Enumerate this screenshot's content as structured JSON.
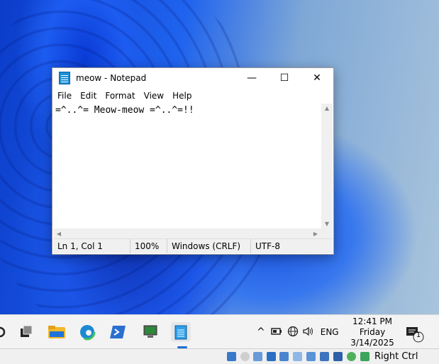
{
  "notepad": {
    "title": "meow - Notepad",
    "window_buttons": {
      "minimize": "—",
      "maximize": "☐",
      "close": "✕"
    },
    "menu": [
      "File",
      "Edit",
      "Format",
      "View",
      "Help"
    ],
    "content": "=^..^= Meow-meow =^..^=!!",
    "status": {
      "position": "Ln 1, Col 1",
      "zoom": "100%",
      "line_ending": "Windows (CRLF)",
      "encoding": "UTF-8"
    }
  },
  "taskbar": {
    "pinned_icons": [
      "search-icon",
      "task-view-icon",
      "file-explorer-icon",
      "edge-icon",
      "powershell-icon",
      "network-computer-icon",
      "notepad-icon"
    ],
    "tray": {
      "language": "ENG",
      "chevron": "^"
    },
    "clock": {
      "time": "12:41 PM",
      "day": "Friday",
      "date": "3/14/2025"
    },
    "notification_count": "1"
  },
  "vbox_bar": {
    "host_key": "Right Ctrl"
  }
}
